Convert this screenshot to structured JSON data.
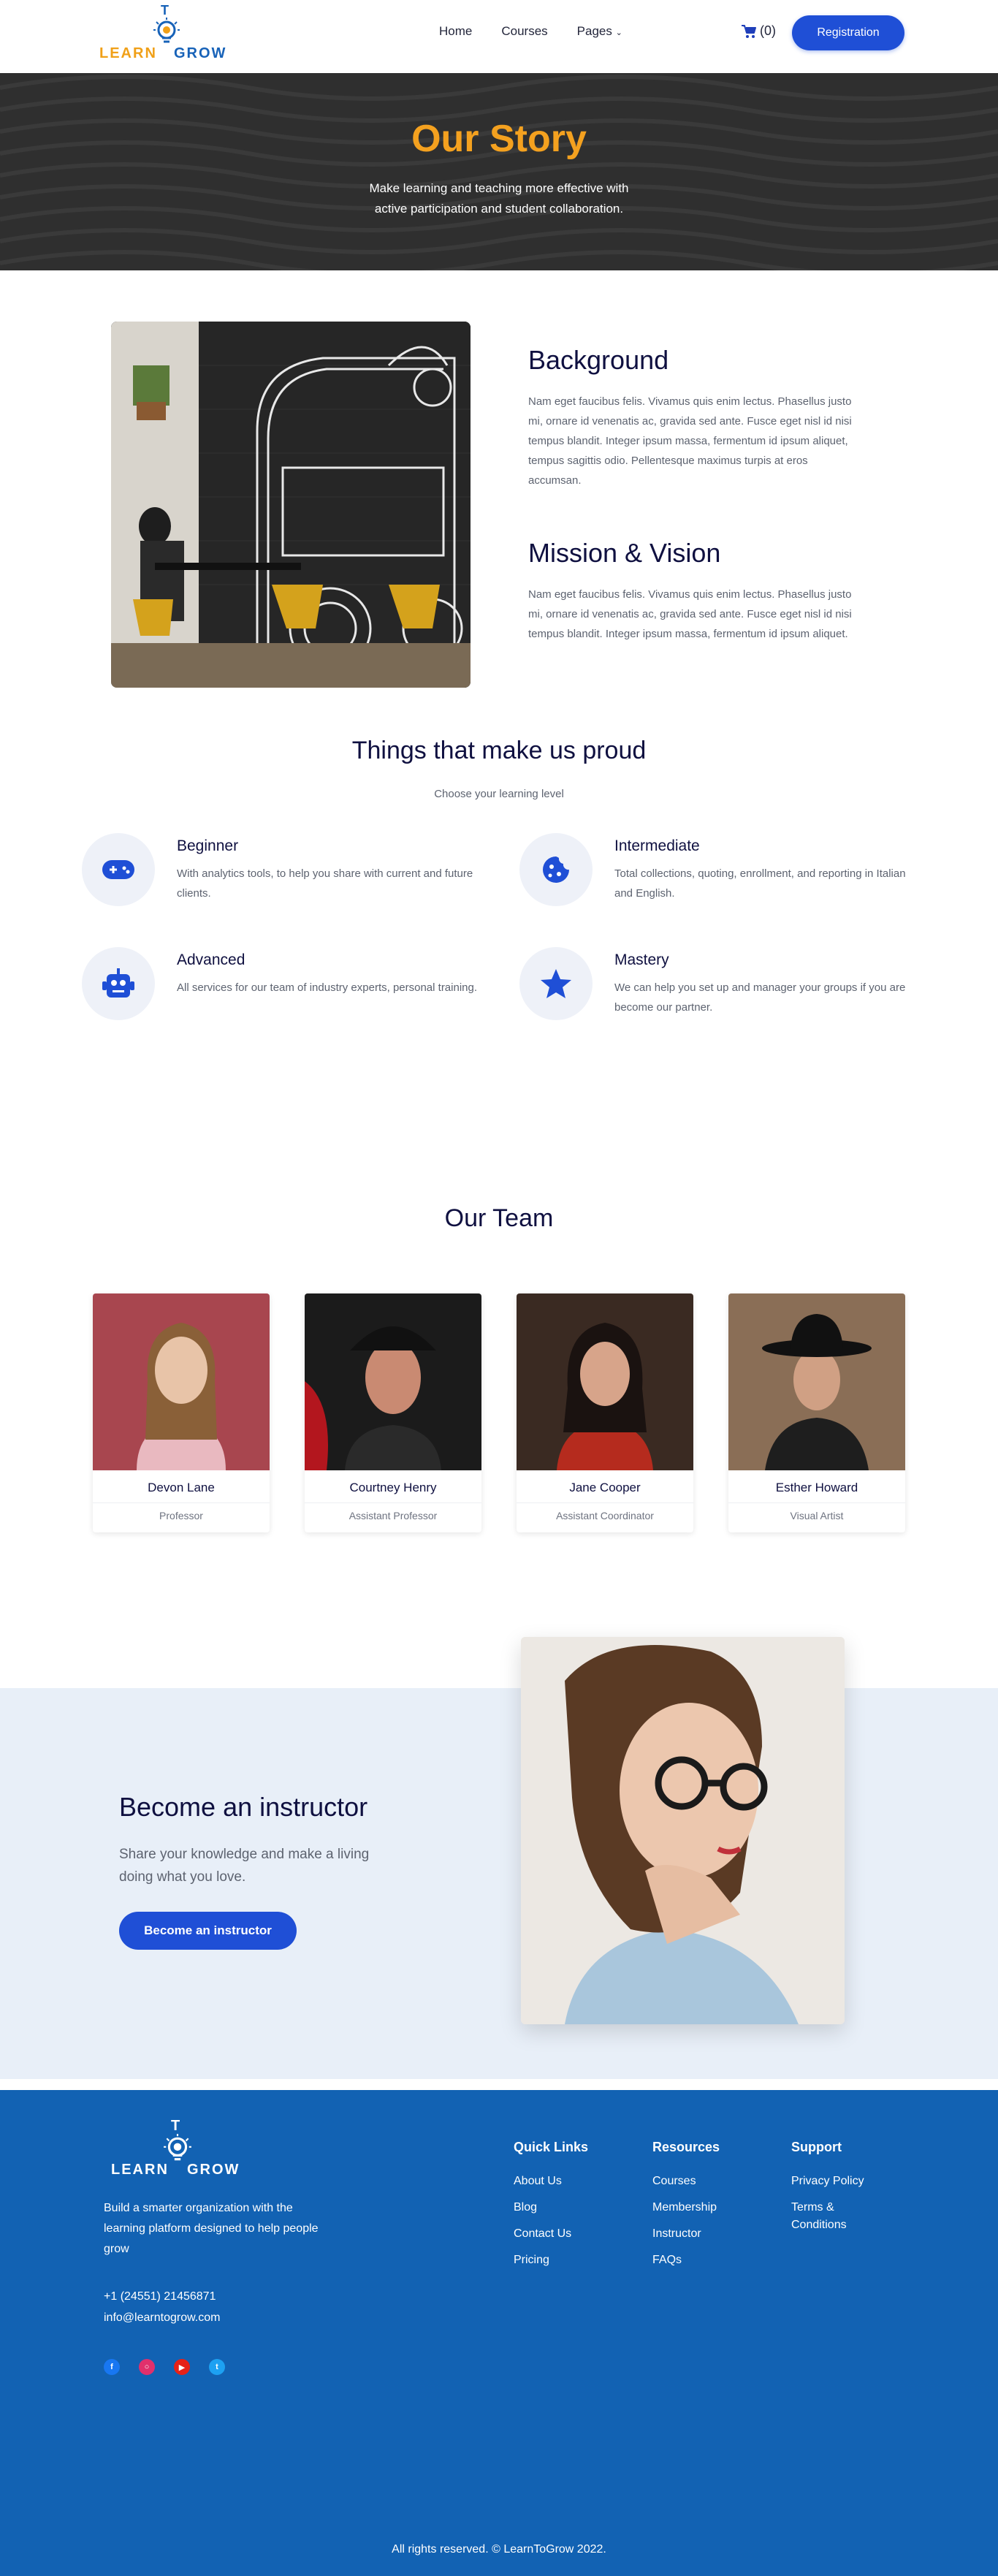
{
  "brand": {
    "t": "T",
    "learn": "LEARN",
    "grow": "GROW"
  },
  "nav": {
    "home": "Home",
    "courses": "Courses",
    "pages": "Pages",
    "cart_count": "(0)",
    "registration": "Registration"
  },
  "hero": {
    "title": "Our Story",
    "subtitle": "Make learning and teaching more effective with active participation and student collaboration."
  },
  "about": {
    "background_title": "Background",
    "background_text": "Nam eget faucibus felis. Vivamus quis enim lectus. Phasellus justo mi, ornare id venenatis ac, gravida sed ante. Fusce eget nisl id nisi tempus blandit. Integer ipsum massa, fermentum id ipsum aliquet, tempus sagittis odio. Pellentesque maximus turpis at eros accumsan.",
    "mission_title": "Mission & Vision",
    "mission_text": "Nam eget faucibus felis. Vivamus quis enim lectus. Phasellus justo mi, ornare id venenatis ac, gravida sed ante. Fusce eget nisl id nisi tempus blandit. Integer ipsum massa, fermentum id ipsum aliquet."
  },
  "proud": {
    "title": "Things that make us proud",
    "subtitle": "Choose your learning level",
    "features": [
      {
        "title": "Beginner",
        "text": "With analytics tools, to help you share with current and future clients.",
        "icon": "gamepad-icon"
      },
      {
        "title": "Intermediate",
        "text": "Total collections, quoting, enrollment, and reporting in Italian and English.",
        "icon": "cookie-icon"
      },
      {
        "title": "Advanced",
        "text": "All services for our team of industry experts, personal training.",
        "icon": "robot-icon"
      },
      {
        "title": "Mastery",
        "text": "We can help you set up and manager your groups if you are become our partner.",
        "icon": "star-icon"
      }
    ]
  },
  "team": {
    "title": "Our Team",
    "members": [
      {
        "name": "Devon Lane",
        "role": "Professor"
      },
      {
        "name": "Courtney Henry",
        "role": "Assistant Professor"
      },
      {
        "name": "Jane Cooper",
        "role": "Assistant Coordinator"
      },
      {
        "name": "Esther Howard",
        "role": "Visual Artist"
      }
    ]
  },
  "instructor": {
    "title": "Become an instructor",
    "text": "Share your knowledge and make a living doing what you love.",
    "button": "Become an instructor"
  },
  "footer": {
    "description": "Build a smarter organization with the learning platform designed to help people grow",
    "phone": "+1 (24551) 21456871",
    "email": "info@learntogrow.com",
    "columns": [
      {
        "title": "Quick Links",
        "links": [
          "About Us",
          "Blog",
          "Contact Us",
          "Pricing"
        ]
      },
      {
        "title": "Resources",
        "links": [
          "Courses",
          "Membership",
          "Instructor",
          "FAQs"
        ]
      },
      {
        "title": "Support",
        "links": [
          "Privacy Policy",
          "Terms & Conditions"
        ]
      }
    ],
    "socials": [
      "facebook-icon",
      "instagram-icon",
      "youtube-icon",
      "twitter-icon"
    ],
    "copyright": "All rights reserved. © LearnToGrow 2022."
  },
  "colors": {
    "primary": "#1f4fd6",
    "accent": "#f4a11f",
    "footer": "#1262b3",
    "heading": "#0f1040"
  }
}
